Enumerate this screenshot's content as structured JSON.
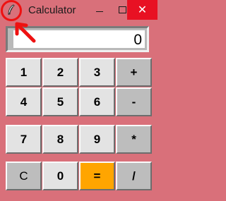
{
  "window": {
    "title": "Calculator",
    "icon": "feather-icon",
    "controls": {
      "minimize": "minimize-icon",
      "maximize": "maximize-icon",
      "close": "✕"
    }
  },
  "display": {
    "value": "0"
  },
  "keys": {
    "row1": [
      "1",
      "2",
      "3",
      "+"
    ],
    "row2": [
      "4",
      "5",
      "6",
      "-"
    ],
    "row3": [
      "7",
      "8",
      "9",
      "*"
    ],
    "row4": [
      "C",
      "0",
      "=",
      "/"
    ]
  },
  "annotation": {
    "color": "#ee1111",
    "shape": "circle-and-arrow"
  },
  "colors": {
    "background": "#d9707a",
    "digit_key": "#e3e3e3",
    "operator_key": "#bdbdbd",
    "equals_key": "#ffa500",
    "close_button": "#e81123"
  }
}
